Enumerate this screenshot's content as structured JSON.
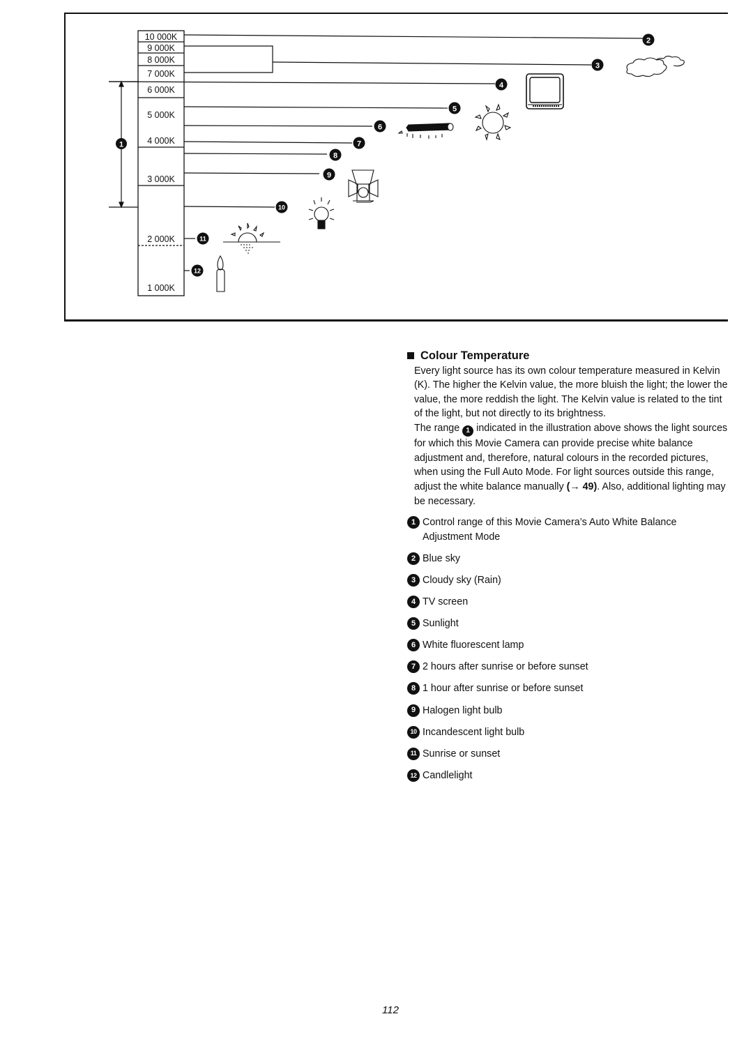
{
  "figure": {
    "kelvin_scale": [
      "10 000K",
      "9 000K",
      "8 000K",
      "7 000K",
      "6 000K",
      "5 000K",
      "4 000K",
      "3 000K",
      "2 000K",
      "1 000K"
    ],
    "range_marker": "1",
    "callouts": [
      "2",
      "3",
      "4",
      "5",
      "6",
      "7",
      "8",
      "9",
      "10",
      "11",
      "12"
    ]
  },
  "section": {
    "title": "Colour Temperature",
    "paragraph1": "Every light source has its own colour temperature measured in Kelvin (K). The higher the Kelvin value, the more bluish the light; the lower the value, the more reddish the light. The Kelvin value is related to the tint of the light, but not directly to its brightness.",
    "paragraph2_before": "The range",
    "paragraph2_badge": "1",
    "paragraph2_after": "indicated in the illustration above shows the light sources for which this Movie Camera can provide precise white balance adjustment and, therefore, natural colours in the recorded pictures, when using the Full Auto Mode. For light sources outside this range, adjust the white balance manually",
    "paragraph2_ref": "(→ 49)",
    "paragraph2_end": ". Also, additional lighting may be necessary."
  },
  "legend": [
    {
      "num": "1",
      "label": "Control range of this Movie Camera’s Auto White Balance Adjustment Mode"
    },
    {
      "num": "2",
      "label": "Blue sky"
    },
    {
      "num": "3",
      "label": "Cloudy sky (Rain)"
    },
    {
      "num": "4",
      "label": "TV screen"
    },
    {
      "num": "5",
      "label": "Sunlight"
    },
    {
      "num": "6",
      "label": "White fluorescent lamp"
    },
    {
      "num": "7",
      "label": "2 hours after sunrise or before sunset"
    },
    {
      "num": "8",
      "label": "1 hour after sunrise or before sunset"
    },
    {
      "num": "9",
      "label": "Halogen light bulb"
    },
    {
      "num": "10",
      "label": "Incandescent light bulb"
    },
    {
      "num": "11",
      "label": "Sunrise or sunset"
    },
    {
      "num": "12",
      "label": "Candlelight"
    }
  ],
  "page_number": "112"
}
